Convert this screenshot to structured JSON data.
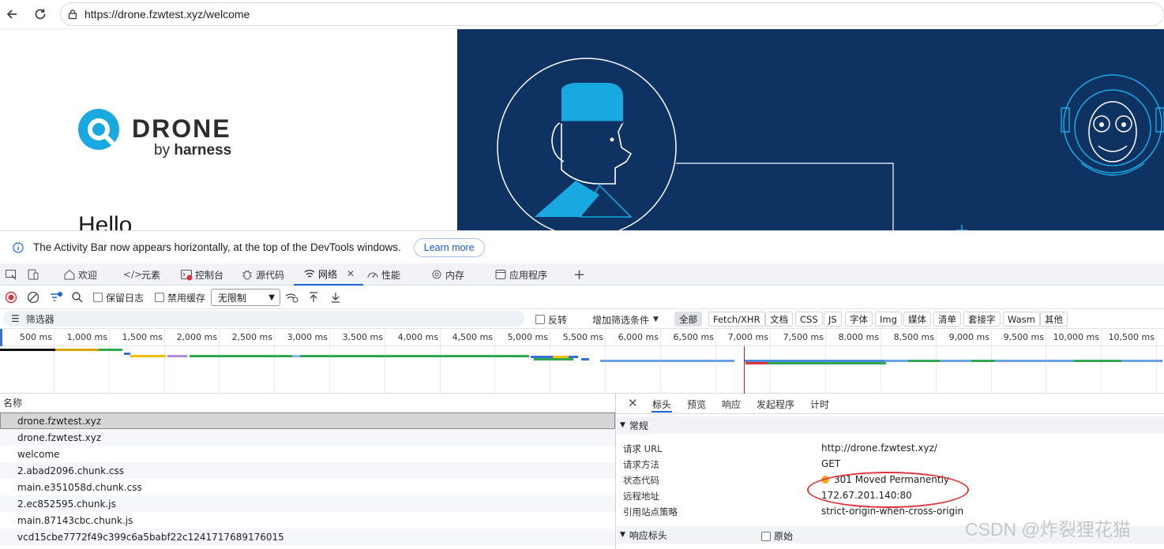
{
  "browser": {
    "url": "https://drone.fzwtest.xyz/welcome"
  },
  "page": {
    "logo_word": "DRONE",
    "logo_by": "by",
    "logo_harness": "harness",
    "hello": "Hello"
  },
  "infobar": {
    "text": "The Activity Bar now appears horizontally, at the top of the DevTools windows.",
    "learn_more": "Learn more"
  },
  "devtools": {
    "tabs": [
      "欢迎",
      "元素",
      "控制台",
      "源代码",
      "网络",
      "性能",
      "内存",
      "应用程序"
    ],
    "active_tab": "网络",
    "toolbar": {
      "preserve_log": "保留日志",
      "disable_cache": "禁用缓存",
      "throttle": "无限制"
    },
    "filter": {
      "placeholder": "筛选器",
      "invert": "反转",
      "more_filters": "增加筛选条件",
      "chips": [
        "全部",
        "Fetch/XHR",
        "文档",
        "CSS",
        "JS",
        "字体",
        "Img",
        "媒体",
        "清单",
        "套接字",
        "Wasm",
        "其他"
      ],
      "active_chip": "全部"
    },
    "timeline": {
      "ticks": [
        "500 ms",
        "1,000 ms",
        "1,500 ms",
        "2,000 ms",
        "2,500 ms",
        "3,000 ms",
        "3,500 ms",
        "4,000 ms",
        "4,500 ms",
        "5,000 ms",
        "5,500 ms",
        "6,000 ms",
        "6,500 ms",
        "7,000 ms",
        "7,500 ms",
        "8,000 ms",
        "8,500 ms",
        "9,000 ms",
        "9,500 ms",
        "10,000 ms",
        "10,500 ms"
      ]
    },
    "requests": {
      "column_name": "名称",
      "rows": [
        "drone.fzwtest.xyz",
        "drone.fzwtest.xyz",
        "welcome",
        "2.abad2096.chunk.css",
        "main.e351058d.chunk.css",
        "2.ec852595.chunk.js",
        "main.87143cbc.chunk.js",
        "vcd15cbe7772f49c399c6a5babf22c1241717689176015"
      ],
      "selected_index": 0
    },
    "details": {
      "tabs": [
        "标头",
        "预览",
        "响应",
        "发起程序",
        "计时"
      ],
      "active_tab": "标头",
      "general_section": "常规",
      "fields": [
        {
          "key": "请求 URL",
          "value": "http://drone.fzwtest.xyz/"
        },
        {
          "key": "请求方法",
          "value": "GET"
        },
        {
          "key": "状态代码",
          "value": "301 Moved Permanently"
        },
        {
          "key": "远程地址",
          "value": "172.67.201.140:80"
        },
        {
          "key": "引用站点策略",
          "value": "strict-origin-when-cross-origin"
        }
      ],
      "response_headers_section": "响应标头",
      "raw_label": "原始"
    }
  },
  "watermark": "CSDN @炸裂狸花猫",
  "colors": {
    "hero_bg": "#0e3262",
    "accent_blue": "#1a64d6",
    "drone_cyan": "#19a9e1",
    "status_orange": "#f5a623",
    "annotation_red": "#e0343c"
  }
}
